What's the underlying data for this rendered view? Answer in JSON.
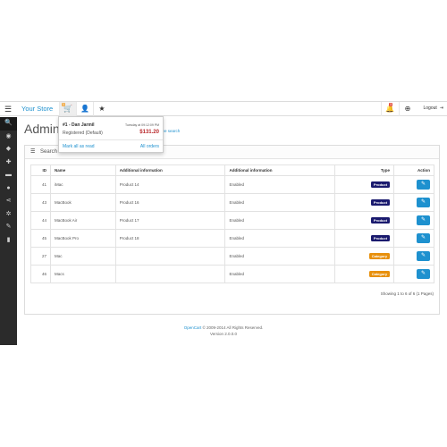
{
  "header": {
    "brand": "Your Store",
    "orders_badge": "1",
    "alerts_badge": "3",
    "logout_label": "Logout",
    "menu_icon": "bars-icon",
    "icons": [
      "shopping-cart-icon",
      "user-icon",
      "star-icon",
      "bell-icon",
      "life-ring-icon",
      "sign-out-icon"
    ]
  },
  "sidebar": {
    "items": [
      "search-icon",
      "dashboard-icon",
      "tags-icon",
      "puzzle-icon",
      "shopping-cart-icon",
      "user-icon",
      "share-icon",
      "gear-icon",
      "wrench-icon",
      "bar-chart-icon"
    ]
  },
  "page": {
    "title": "Admini",
    "crumb_link": "…rative search"
  },
  "dropdown": {
    "name": "#1 - Dan Jarmil",
    "date": "Tuesday at 09:12:09 PM",
    "status": "Registered (Default)",
    "total": "$131.20",
    "mark_all": "Mark all as read",
    "all_orders": "All orders"
  },
  "panel": {
    "title": "Search …"
  },
  "table": {
    "headers": [
      "ID",
      "Name",
      "Additional information",
      "Additional information",
      "Type",
      "Action"
    ],
    "rows": [
      {
        "id": "41",
        "name": "iMac",
        "info1": "Product 14",
        "info2": "Enabled",
        "type": "Product",
        "type_color": "#1a1a6e"
      },
      {
        "id": "43",
        "name": "MacBook",
        "info1": "Product 16",
        "info2": "Enabled",
        "type": "Product",
        "type_color": "#1a1a6e"
      },
      {
        "id": "44",
        "name": "MacBook Air",
        "info1": "Product 17",
        "info2": "Enabled",
        "type": "Product",
        "type_color": "#1a1a6e"
      },
      {
        "id": "45",
        "name": "MacBook Pro",
        "info1": "Product 18",
        "info2": "Enabled",
        "type": "Product",
        "type_color": "#1a1a6e"
      },
      {
        "id": "27",
        "name": "Mac",
        "info1": "",
        "info2": "Enabled",
        "type": "Category",
        "type_color": "#e8900c"
      },
      {
        "id": "46",
        "name": "Macs",
        "info1": "",
        "info2": "Enabled",
        "type": "Category",
        "type_color": "#e8900c"
      }
    ],
    "showing": "Showing 1 to 6 of 6 (1 Pages)"
  },
  "footer": {
    "link": "OpenCart",
    "text": " © 2009-2014 All Rights Reserved.",
    "version": "Version 2.0.0.0"
  }
}
